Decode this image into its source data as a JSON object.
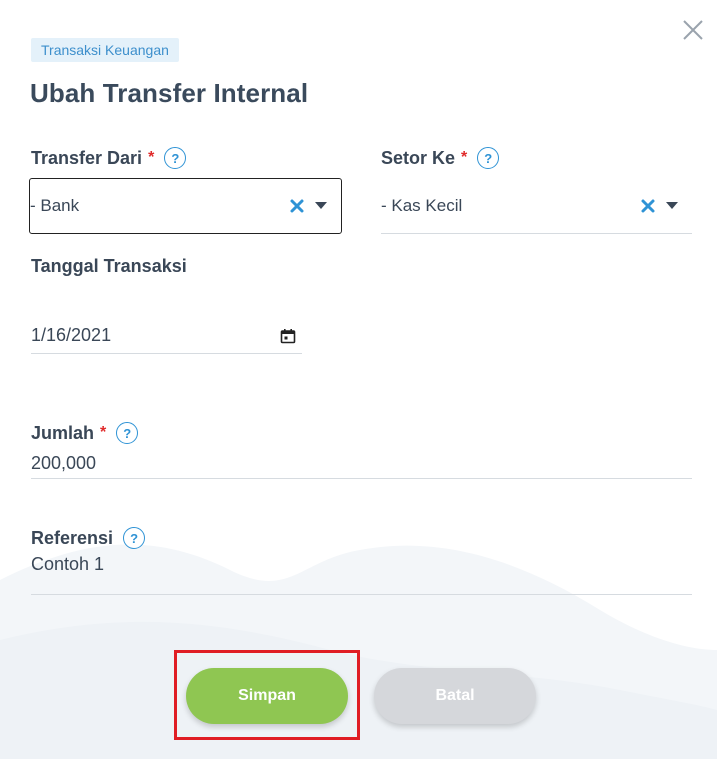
{
  "dialog": {
    "badge": "Transaksi Keuangan",
    "title": "Ubah Transfer Internal"
  },
  "form": {
    "transfer_from": {
      "label": "Transfer Dari",
      "required_mark": "*",
      "value": "- Bank"
    },
    "deposit_to": {
      "label": "Setor Ke",
      "required_mark": "*",
      "value": "- Kas Kecil"
    },
    "transaction_date": {
      "label": "Tanggal Transaksi",
      "value": "1/16/2021"
    },
    "amount": {
      "label": "Jumlah",
      "required_mark": "*",
      "value": "200,000"
    },
    "reference": {
      "label": "Referensi",
      "value": "Contoh 1"
    }
  },
  "help_glyph": "?",
  "actions": {
    "save_label": "Simpan",
    "cancel_label": "Batal"
  },
  "icons": {
    "close": "close-icon",
    "help": "question-circle-icon",
    "clear": "x-icon",
    "caret": "caret-down-icon",
    "calendar": "calendar-icon"
  },
  "colors": {
    "save": "#8fc652",
    "cancel": "#d5d7db",
    "accent": "#2f93d5",
    "required": "#e02b2b",
    "highlight": "#e01d24"
  }
}
